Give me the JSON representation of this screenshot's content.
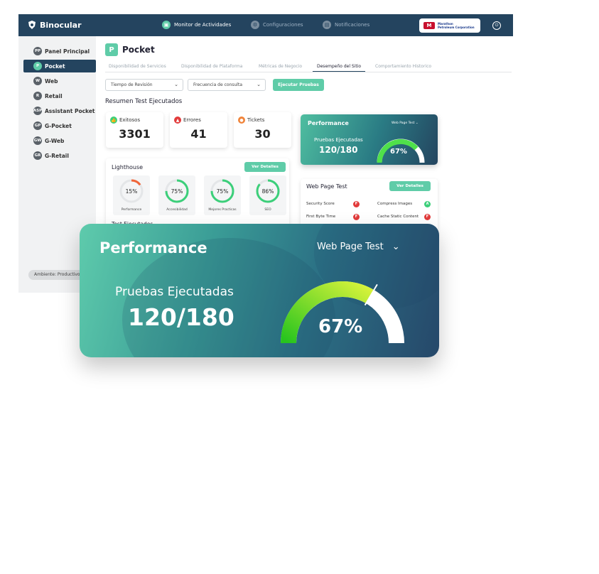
{
  "app": {
    "brand": "Binocular",
    "nav": [
      {
        "label": "Monitor de Actividades",
        "active": true
      },
      {
        "label": "Configuraciones",
        "active": false
      },
      {
        "label": "Notificaciones",
        "active": false
      }
    ],
    "partner": {
      "mark": "M",
      "line1": "Marathon",
      "line2": "Petroleum Corporation"
    }
  },
  "sidebar": {
    "items": [
      {
        "badge": "PP",
        "label": "Panel Principal"
      },
      {
        "badge": "P",
        "label": "Pocket"
      },
      {
        "badge": "W",
        "label": "Web"
      },
      {
        "badge": "R",
        "label": "Retail"
      },
      {
        "badge": "ASP",
        "label": "Assistant Pocket"
      },
      {
        "badge": "GP",
        "label": "G-Pocket"
      },
      {
        "badge": "GW",
        "label": "G-Web"
      },
      {
        "badge": "GR",
        "label": "G-Retail"
      }
    ],
    "environment": "Ambiente: Productivo"
  },
  "main": {
    "page_badge": "P",
    "page_title": "Pocket",
    "tabs": [
      "Disponibilidad de Servicios",
      "Disponibilidad de Plataforma",
      "Métricas de Negocio",
      "Desempeño del Sitio",
      "Comportamiento Historico"
    ],
    "active_tab": "Desempeño del Sitio",
    "filters": {
      "time": "Tiempo de Revisión",
      "frequency": "Frecuencia de consulta",
      "run_button": "Ejecutar Pruebas"
    },
    "summary_title": "Resumen Test Ejecutados",
    "stats": [
      {
        "label": "Exitosos",
        "value": "3301",
        "color": "#3ccf7a"
      },
      {
        "label": "Errores",
        "value": "41",
        "color": "#e23b3b"
      },
      {
        "label": "Tickets",
        "value": "30",
        "color": "#f0843a"
      }
    ],
    "lighthouse": {
      "title": "Lighthouse",
      "button": "Ver Detalles",
      "items": [
        {
          "value": "15%",
          "label": "Performance",
          "percent": 15,
          "color": "#f0663a"
        },
        {
          "value": "75%",
          "label": "Accesibilidad",
          "percent": 75,
          "color": "#3ccf7a"
        },
        {
          "value": "75%",
          "label": "Mejores Practicas",
          "percent": 75,
          "color": "#3ccf7a"
        },
        {
          "value": "86%",
          "label": "SEO",
          "percent": 86,
          "color": "#3ccf7a"
        }
      ],
      "footer": "Test Ejecutados"
    },
    "web_page_test": {
      "title": "Web Page Test",
      "button": "Ver Detalles",
      "rows": [
        {
          "label": "Security Score",
          "grade": "F",
          "color": "#e23b3b"
        },
        {
          "label": "Compress Images",
          "grade": "A",
          "color": "#3ccf7a"
        },
        {
          "label": "First Byte Time",
          "grade": "F",
          "color": "#e23b3b"
        },
        {
          "label": "Cache Static Content",
          "grade": "F",
          "color": "#e23b3b"
        }
      ]
    }
  },
  "performance": {
    "title": "Performance",
    "selector": "Web Page Test",
    "tests_label": "Pruebas Ejecutadas",
    "tests_value": "120/180",
    "gauge_value": "67%",
    "gauge_fraction": 0.67
  }
}
